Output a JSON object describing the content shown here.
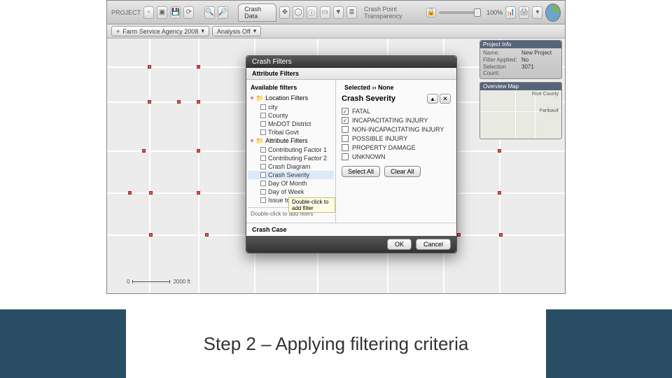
{
  "caption": "Step 2 – Applying filtering criteria",
  "toolbar": {
    "project_label": "PROJECT",
    "tab_label": "Crash Data",
    "transparency_label": "Crash Point Transparency",
    "transparency_value": "100%"
  },
  "subbar": {
    "basemap_select": "Farm Service Agency 2008",
    "analysis_select": "Analysis Off"
  },
  "info_panel": {
    "header": "Project Info",
    "name_label": "Name:",
    "name_value": "New Project",
    "filter_label": "Filter Applied:",
    "filter_value": "No",
    "selcount_label": "Selection Count:",
    "selcount_value": "3071"
  },
  "minimap": {
    "header": "Overview Map",
    "region": "Rice County",
    "city": "Faribault"
  },
  "scale": {
    "zero": "0",
    "dist": "2000 ft"
  },
  "dialog": {
    "title": "Crash Filters",
    "subtitle": "Attribute Filters",
    "available_label": "Available filters",
    "selected_label": "Selected ›› None",
    "groups": {
      "location": "Location Filters",
      "attribute": "Attribute Filters"
    },
    "location_items": [
      "city",
      "County",
      "MnDOT District",
      "Tribal Govt"
    ],
    "attribute_items": [
      "Contributing Factor 1",
      "Contributing Factor 2",
      "Crash Diagram",
      "Crash Severity",
      "Day Of Month",
      "Day of Week",
      "Issue too"
    ],
    "help_hint": "Double-click to add filter",
    "left_footer": "Double-click to add filters",
    "severity": {
      "header": "Crash Severity",
      "options": [
        {
          "label": "FATAL",
          "checked": true
        },
        {
          "label": "INCAPACITATING INJURY",
          "checked": true
        },
        {
          "label": "NON-INCAPACITATING INJURY",
          "checked": false
        },
        {
          "label": "POSSIBLE INJURY",
          "checked": false
        },
        {
          "label": "PROPERTY DAMAGE",
          "checked": false
        },
        {
          "label": "UNKNOWN",
          "checked": false
        }
      ],
      "select_all": "Select All",
      "clear_all": "Clear All"
    },
    "case_section": "Crash Case",
    "ok": "OK",
    "cancel": "Cancel"
  }
}
